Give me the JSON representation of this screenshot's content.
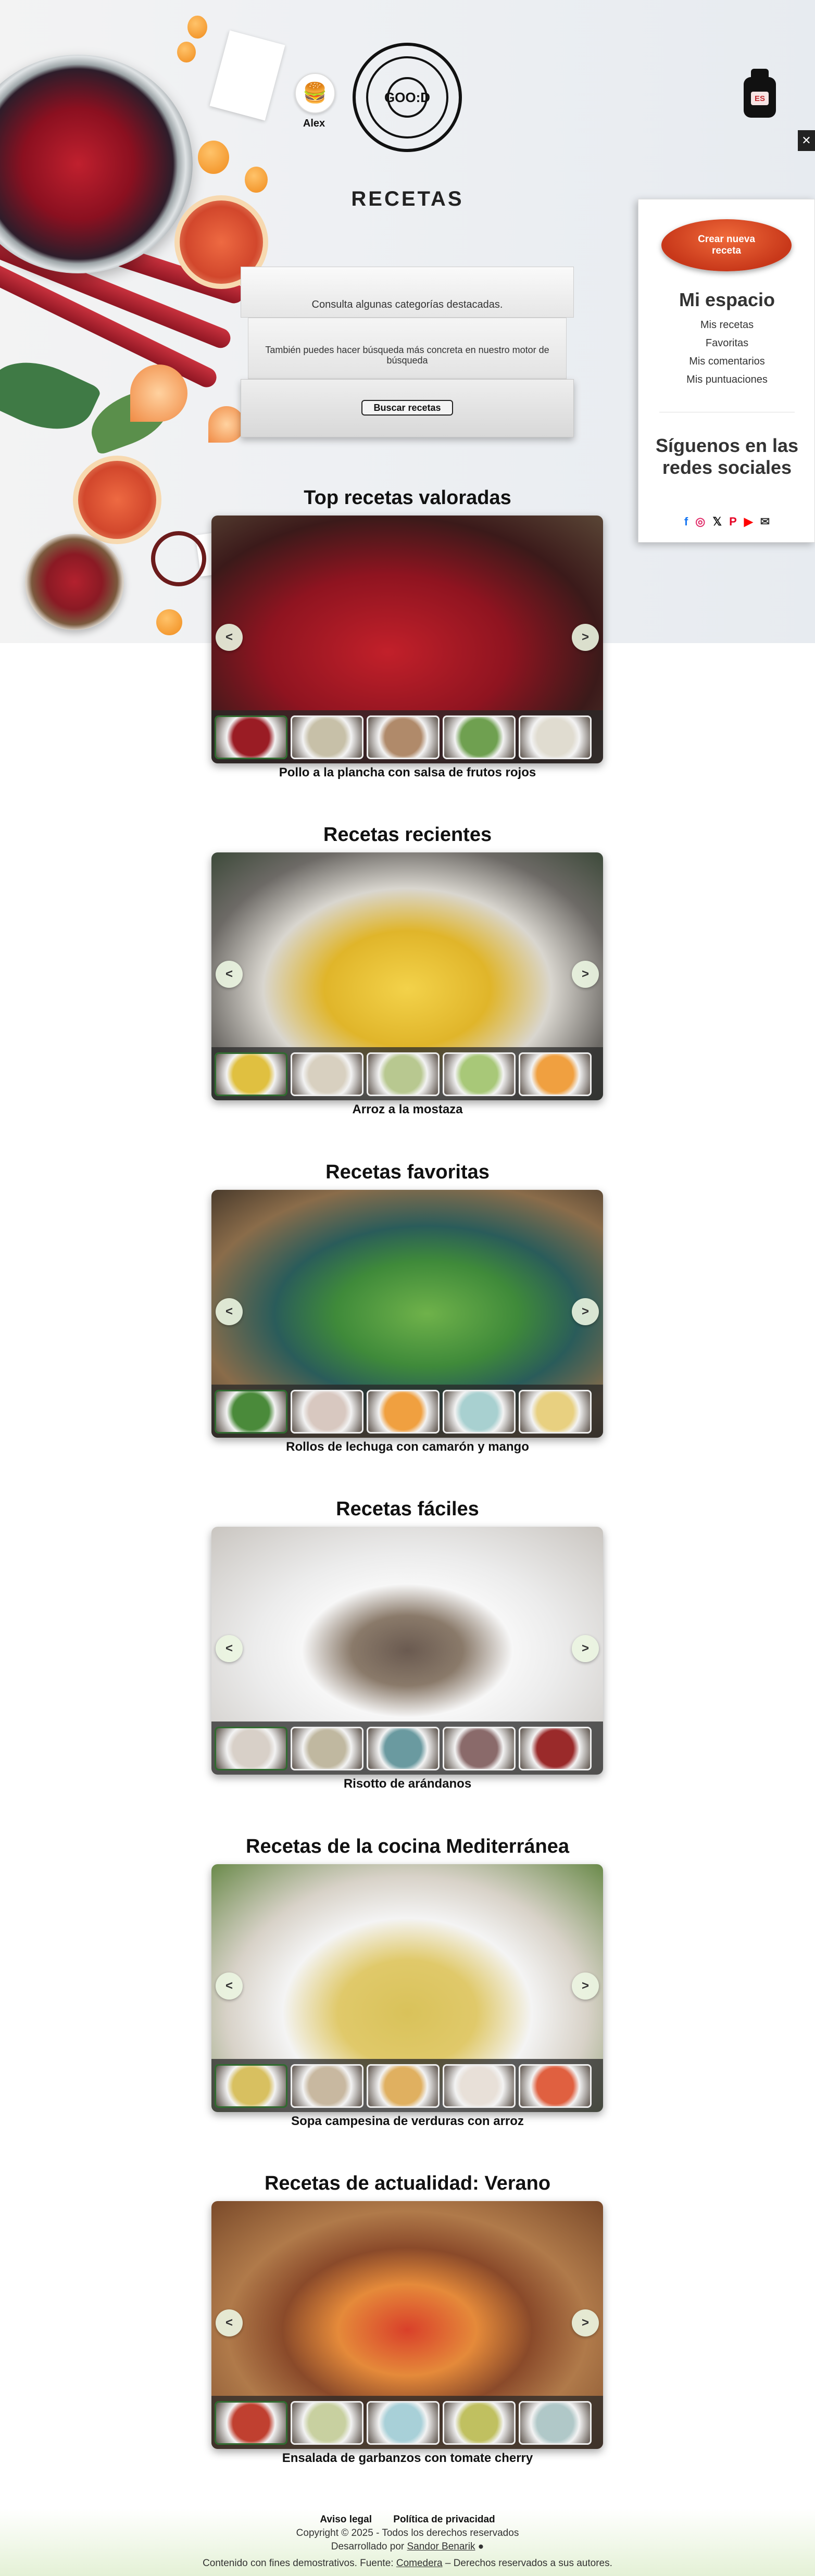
{
  "header": {
    "user": {
      "name": "Alex",
      "avatar_icon": "burger-icon"
    },
    "logo_text": "GOO:D",
    "language": "ES",
    "close_symbol": "✕",
    "page_title": "RECETAS"
  },
  "search_card": {
    "line1": "Consulta algunas categorías destacadas.",
    "line2": "También puedes hacer búsqueda más concreta en nuestro motor de búsqueda",
    "button": "Buscar recetas"
  },
  "sidebar": {
    "create_button": "Crear nueva receta",
    "space_title": "Mi espacio",
    "links": [
      "Mis recetas",
      "Favoritas",
      "Mis comentarios",
      "Mis puntuaciones"
    ],
    "social_title": "Síguenos en las redes sociales",
    "social_icons": [
      {
        "name": "facebook-icon",
        "glyph": "f",
        "color": "#1877f2"
      },
      {
        "name": "instagram-icon",
        "glyph": "◎",
        "color": "#e1306c"
      },
      {
        "name": "x-icon",
        "glyph": "𝕏",
        "color": "#111111"
      },
      {
        "name": "pinterest-icon",
        "glyph": "P",
        "color": "#e60023"
      },
      {
        "name": "youtube-icon",
        "glyph": "▶",
        "color": "#ff0000"
      },
      {
        "name": "mail-icon",
        "glyph": "✉",
        "color": "#333333"
      }
    ]
  },
  "carousel_nav": {
    "prev": "<",
    "next": ">"
  },
  "sections": [
    {
      "title": "Top recetas valoradas",
      "caption": "Pollo a la plancha con salsa de frutos rojos"
    },
    {
      "title": "Recetas recientes",
      "caption": "Arroz a la mostaza"
    },
    {
      "title": "Recetas favoritas",
      "caption": "Rollos de lechuga con camarón y mango"
    },
    {
      "title": "Recetas fáciles",
      "caption": "Risotto de arándanos"
    },
    {
      "title": "Recetas de la cocina Mediterránea",
      "caption": "Sopa campesina de verduras con arroz"
    },
    {
      "title": "Recetas de actualidad: Verano",
      "caption": "Ensalada de garbanzos con tomate cherry"
    }
  ],
  "footer": {
    "legal": "Aviso legal",
    "privacy": "Política de privacidad",
    "copyright": "Copyright © 2025 - Todos los derechos reservados",
    "developed_prefix": "Desarrollado por",
    "developer": "Sandor Benarik",
    "github_icon": "github-icon",
    "demo_prefix": "Contenido con fines demostrativos. Fuente:",
    "source": "Comedera",
    "demo_suffix": "– Derechos reservados a sus autores."
  }
}
